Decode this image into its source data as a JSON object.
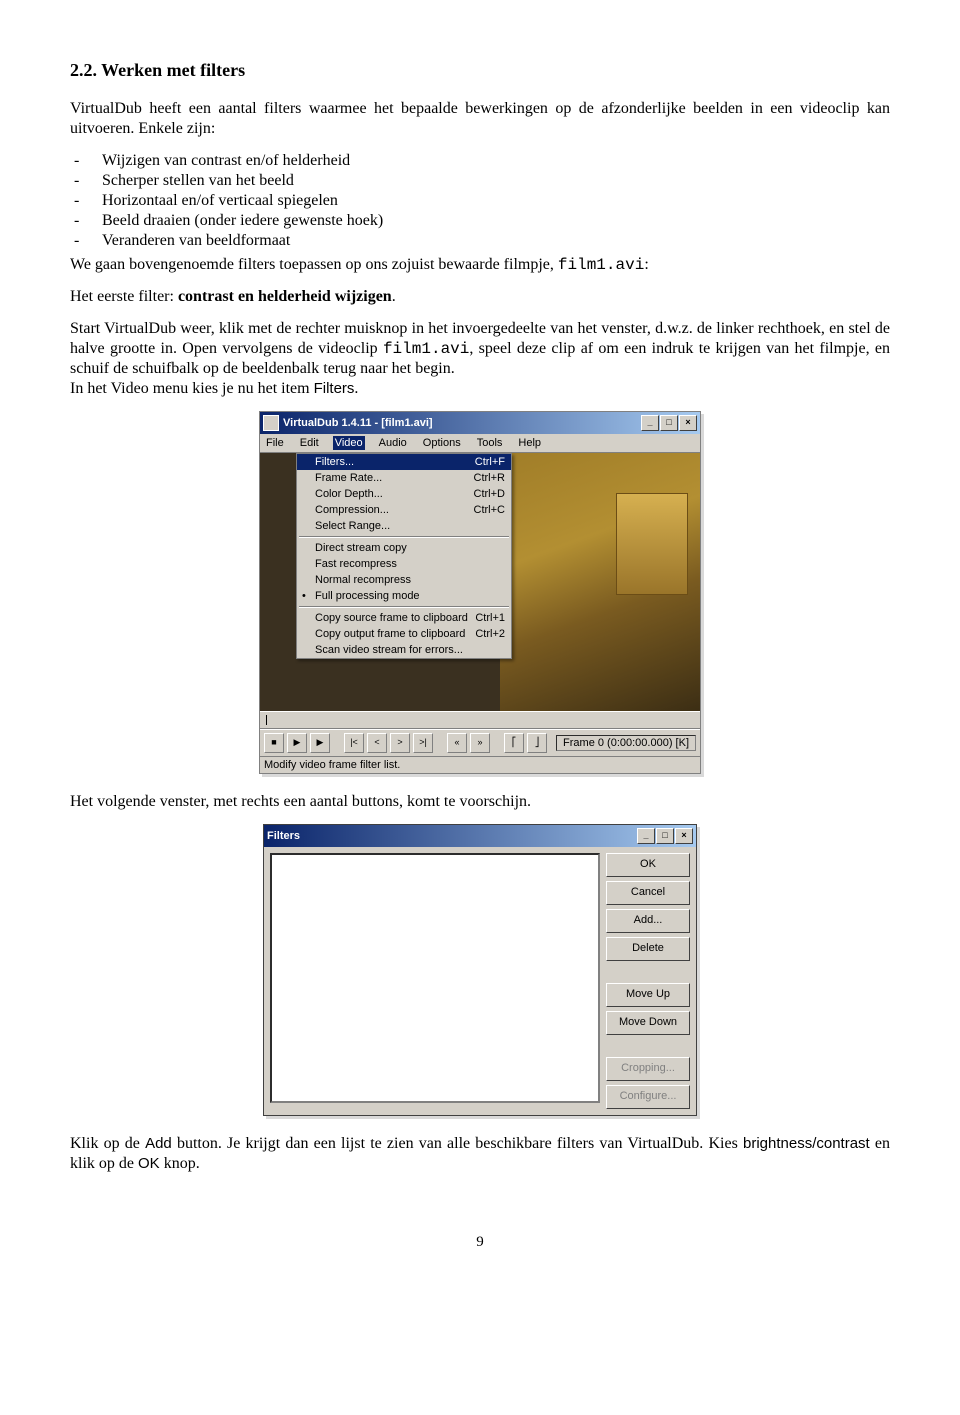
{
  "heading": "2.2. Werken met filters",
  "para_intro": "VirtualDub heeft een aantal filters waarmee het bepaalde bewerkingen op de afzonderlijke beelden in een videoclip kan uitvoeren. Enkele zijn:",
  "list_items": [
    "Wijzigen van contrast en/of helderheid",
    "Scherper stellen van het beeld",
    "Horizontaal en/of verticaal spiegelen",
    "Beeld draaien (onder iedere gewenste hoek)",
    "Veranderen van beeldformaat"
  ],
  "para_after_list_1": "We gaan bovengenoemde filters toepassen op ons zojuist bewaarde filmpje, ",
  "para_after_list_mono": "film1.avi",
  "para_after_list_2": ":",
  "para_first_filter_1": "Het eerste filter: ",
  "para_first_filter_bold": "contrast en helderheid wijzigen",
  "para_first_filter_2": ".",
  "para_start_1": "Start VirtualDub weer, klik met de rechter muisknop in het invoergedeelte van het venster, d.w.z. de linker rechthoek, en stel de halve grootte in. Open vervolgens de videoclip ",
  "para_start_mono": "film1.avi",
  "para_start_2": ", speel deze clip af om een indruk te krijgen van het filmpje, en schuif de schuifbalk op de beeldenbalk terug naar het begin.",
  "para_in_video_1": "In het Video menu kies je nu het item ",
  "para_in_video_sans": "Filters",
  "para_in_video_2": ".",
  "vd": {
    "title": "VirtualDub 1.4.11 - [film1.avi]",
    "menus": [
      "File",
      "Edit",
      "Video",
      "Audio",
      "Options",
      "Tools",
      "Help"
    ],
    "open_menu_index": 2,
    "dropdown": [
      {
        "label": "Filters...",
        "key": "Ctrl+F",
        "sel": true
      },
      {
        "label": "Frame Rate...",
        "key": "Ctrl+R"
      },
      {
        "label": "Color Depth...",
        "key": "Ctrl+D"
      },
      {
        "label": "Compression...",
        "key": "Ctrl+C"
      },
      {
        "label": "Select Range...",
        "key": ""
      },
      {
        "sep": true
      },
      {
        "label": "Direct stream copy",
        "key": ""
      },
      {
        "label": "Fast recompress",
        "key": ""
      },
      {
        "label": "Normal recompress",
        "key": ""
      },
      {
        "label": "Full processing mode",
        "key": "",
        "bullet": true
      },
      {
        "sep": true
      },
      {
        "label": "Copy source frame to clipboard",
        "key": "Ctrl+1"
      },
      {
        "label": "Copy output frame to clipboard",
        "key": "Ctrl+2"
      },
      {
        "label": "Scan video stream for errors...",
        "key": ""
      }
    ],
    "frame_label": "Frame 0 (0:00:00.000) [K]",
    "status": "Modify video frame filter list."
  },
  "para_next_window": "Het volgende venster, met rechts een aantal buttons, komt te voorschijn.",
  "filters_dialog": {
    "title": "Filters",
    "buttons": [
      "OK",
      "Cancel",
      "Add...",
      "Delete"
    ],
    "buttons2": [
      "Move Up",
      "Move Down"
    ],
    "buttons3": [
      "Cropping...",
      "Configure..."
    ]
  },
  "para_add_1": "Klik op de ",
  "para_add_sans1": "Add",
  "para_add_2": " button. Je krijgt dan een lijst te zien van alle beschikbare filters van VirtualDub. Kies ",
  "para_add_sans2": "brightness/contrast",
  "para_add_3": " en klik op de ",
  "para_add_sans3": "OK",
  "para_add_4": " knop.",
  "page_number": "9"
}
